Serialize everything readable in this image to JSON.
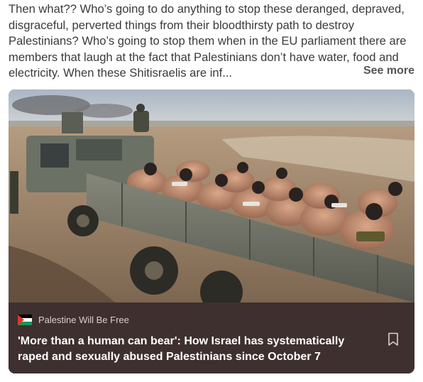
{
  "post": {
    "text_lines": [
      "Then what?? Who’s going to do anything to stop these deranged, depraved,",
      "disgraceful, perverted things from their bloodthirsty path to destroy",
      "Palestinians? Who’s going to stop them when in the EU parliament there are",
      "members that laugh at the fact that Palestinians don’t have water, food and",
      "electricity. When these Shitisraelis are inf..."
    ],
    "see_more_label": "See more"
  },
  "card": {
    "image_icon": "photo-of-detainees-in-military-truck",
    "source_icon": "palestine-flag-icon",
    "source_name": "Palestine Will Be Free",
    "headline": "'More than a human can bear': How Israel has systematically raped and sexually abused Palestinians since October 7",
    "bookmark_icon": "bookmark-icon"
  },
  "colors": {
    "text": "#3b3b3b",
    "card_footer": "#3e302f",
    "headline": "#ffffff",
    "source": "#d9cfcc"
  }
}
